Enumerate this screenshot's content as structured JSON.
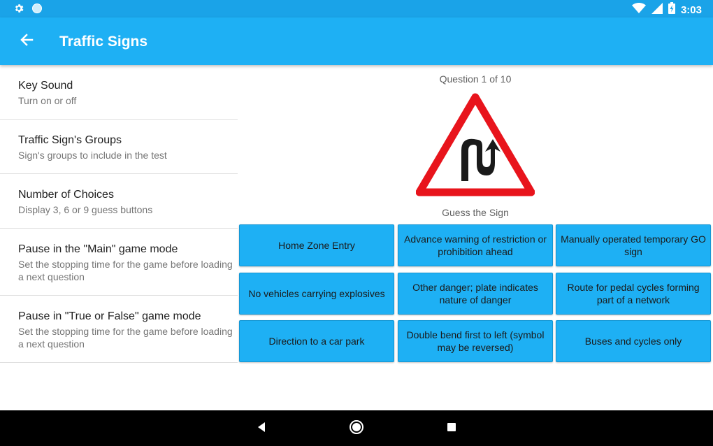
{
  "status_bar": {
    "time": "3:03"
  },
  "app_bar": {
    "title": "Traffic Signs"
  },
  "settings": [
    {
      "title": "Key Sound",
      "summary": "Turn on or off"
    },
    {
      "title": "Traffic Sign's Groups",
      "summary": "Sign's groups to include in the test"
    },
    {
      "title": "Number of Choices",
      "summary": "Display 3, 6 or 9 guess buttons"
    },
    {
      "title": "Pause in the \"Main\" game mode",
      "summary": "Set the stopping time for the game before loading a next question"
    },
    {
      "title": "Pause in \"True or False\" game mode",
      "summary": "Set the stopping time for the game before loading a next question"
    }
  ],
  "quiz": {
    "counter": "Question 1 of 10",
    "prompt": "Guess the Sign",
    "sign_icon": "double-bend-warning-sign",
    "choices": [
      "Home Zone Entry",
      "Advance warning of restriction or prohibition ahead",
      "Manually operated temporary GO sign",
      "No vehicles carrying explosives",
      "Other danger; plate indicates nature of danger",
      "Route for pedal cycles forming part of a network",
      "Direction to a car park",
      "Double bend first to left (symbol may be reversed)",
      "Buses and cycles only"
    ]
  },
  "colors": {
    "app_bar": "#1eb0f4",
    "status_bar": "#1aa3e8",
    "choice_button": "#1eb0f4",
    "sign_border": "#e8141c"
  }
}
